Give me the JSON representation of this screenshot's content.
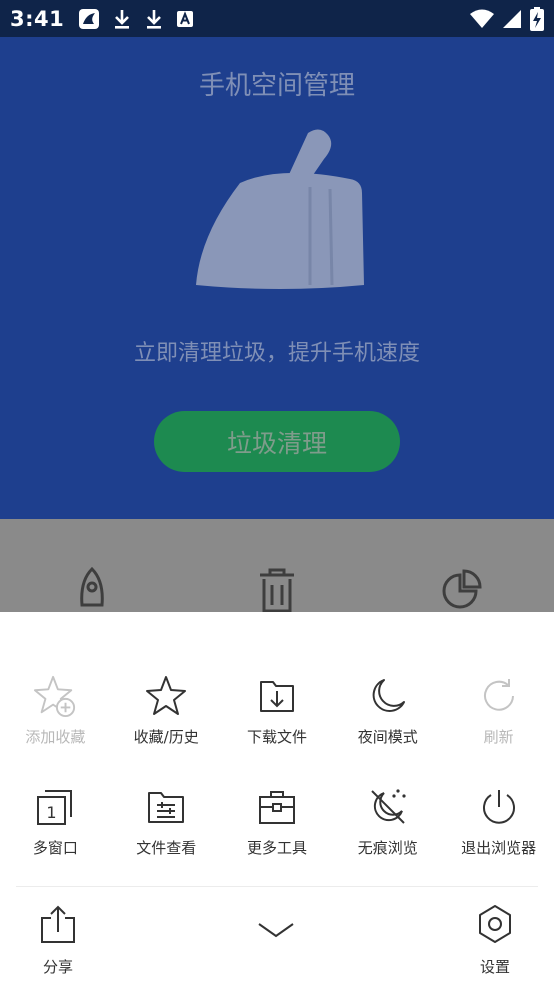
{
  "status_bar": {
    "time": "3:41",
    "notification_icons": [
      "app-icon",
      "download-icon",
      "download-icon",
      "font-icon"
    ],
    "system_icons": [
      "wifi-icon",
      "signal-icon",
      "battery-charging-icon"
    ]
  },
  "background_app": {
    "title": "手机空间管理",
    "subtitle": "立即清理垃圾，提升手机速度",
    "clean_button": "垃圾清理",
    "icons": [
      "rocket-icon",
      "trash-icon",
      "pie-chart-icon"
    ]
  },
  "menu": {
    "row1": [
      {
        "label": "添加收藏",
        "icon": "star-add-icon",
        "enabled": false
      },
      {
        "label": "收藏/历史",
        "icon": "star-icon",
        "enabled": true
      },
      {
        "label": "下载文件",
        "icon": "download-folder-icon",
        "enabled": true
      },
      {
        "label": "夜间模式",
        "icon": "moon-icon",
        "enabled": true
      },
      {
        "label": "刷新",
        "icon": "refresh-icon",
        "enabled": false
      }
    ],
    "row2": [
      {
        "label": "多窗口",
        "icon": "multi-window-icon",
        "enabled": true
      },
      {
        "label": "文件查看",
        "icon": "file-view-icon",
        "enabled": true
      },
      {
        "label": "更多工具",
        "icon": "toolbox-icon",
        "enabled": true
      },
      {
        "label": "无痕浏览",
        "icon": "incognito-icon",
        "enabled": true
      },
      {
        "label": "退出浏览器",
        "icon": "power-icon",
        "enabled": true
      }
    ],
    "bottom": {
      "share": "分享",
      "collapse_icon": "chevron-down-icon",
      "settings": "设置"
    }
  }
}
